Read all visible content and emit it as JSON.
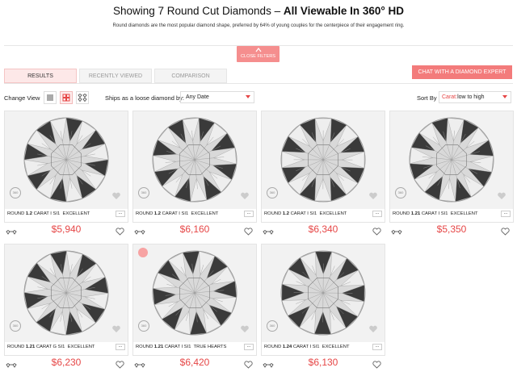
{
  "header": {
    "title_prefix": "Showing 7 Round Cut Diamonds – ",
    "title_bold": "All Viewable In 360° HD",
    "subtitle": "Round diamonds are the most popular diamond shape, preferred by 64% of young couples for the centerpiece of their engagement ring."
  },
  "filters": {
    "close_label": "CLOSE FILTERS"
  },
  "tabs": [
    {
      "label": "RESULTS",
      "active": true
    },
    {
      "label": "RECENTLY VIEWED",
      "active": false
    },
    {
      "label": "COMPARISON",
      "active": false
    }
  ],
  "chat_button": "CHAT WITH A DIAMOND EXPERT",
  "toolbar": {
    "change_view": "Change View",
    "ships_label": "Ships as a loose diamond by:",
    "ships_value": "Any Date",
    "sort_label": "Sort By",
    "sort_prefix": "Carat:",
    "sort_value": "low to high"
  },
  "colors": {
    "accent": "#e64646",
    "chat": "#f37b7b",
    "filter_tab": "#f58e8e"
  },
  "results": [
    {
      "shape": "ROUND",
      "carat": "1.2",
      "grade": "CARAT I SI1",
      "cut": "EXCELLENT",
      "price": "$5,940"
    },
    {
      "shape": "ROUND",
      "carat": "1.2",
      "grade": "CARAT I SI1",
      "cut": "EXCELLENT",
      "price": "$6,160"
    },
    {
      "shape": "ROUND",
      "carat": "1.2",
      "grade": "CARAT I SI1",
      "cut": "EXCELLENT",
      "price": "$6,340"
    },
    {
      "shape": "ROUND",
      "carat": "1.21",
      "grade": "CARAT I SI1",
      "cut": "EXCELLENT",
      "price": "$5,350"
    },
    {
      "shape": "ROUND",
      "carat": "1.21",
      "grade": "CARAT G SI1",
      "cut": "EXCELLENT",
      "price": "$6,230"
    },
    {
      "shape": "ROUND",
      "carat": "1.21",
      "grade": "CARAT I SI1",
      "cut": "TRUE HEARTS",
      "price": "$6,420"
    },
    {
      "shape": "ROUND",
      "carat": "1.24",
      "grade": "CARAT I SI1",
      "cut": "EXCELLENT",
      "price": "$6,130"
    }
  ]
}
